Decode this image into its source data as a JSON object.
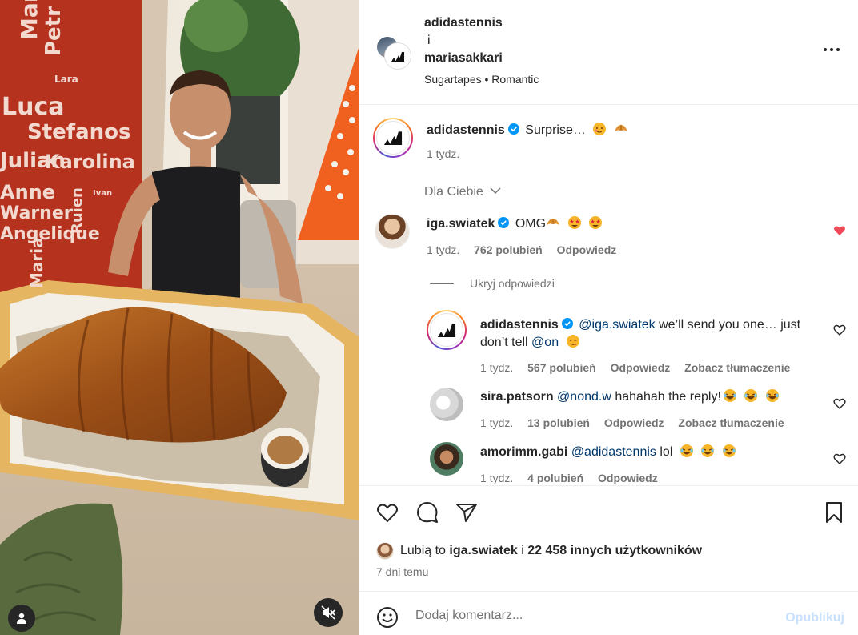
{
  "post": {
    "author": "adidastennis",
    "conjunction": "i",
    "coauthor": "mariasakkari",
    "audio": "Sugartapes • Romantic",
    "caption_text": "Surprise…",
    "caption_time": "1 tydz."
  },
  "media": {
    "wall_names": [
      "Martin",
      "Petr",
      "Lara",
      "Luca",
      "Stefanos",
      "Julian",
      "Karolina",
      "Ivan",
      "Anne",
      "Warner",
      "Ruien",
      "Angelique",
      "Maria"
    ]
  },
  "section_label": "Dla Ciebie",
  "comments": [
    {
      "user": "iga.swiatek",
      "text": "OMG",
      "time": "1 tydz.",
      "likes": "762 polubień",
      "reply": "Odpowiedz",
      "liked": true
    }
  ],
  "hide_replies_label": "Ukryj odpowiedzi",
  "replies": [
    {
      "user": "adidastennis",
      "mention": "@iga.swiatek",
      "text_a": "we’ll send you one… just",
      "text_b": "don’t tell",
      "mention_b": "@on",
      "time": "1 tydz.",
      "likes": "567 polubień",
      "reply": "Odpowiedz",
      "translate": "Zobacz tłumaczenie"
    },
    {
      "user": "sira.patsorn",
      "mention": "@nond.w",
      "text": "hahahah the reply!",
      "time": "1 tydz.",
      "likes": "13 polubień",
      "reply": "Odpowiedz",
      "translate": "Zobacz tłumaczenie"
    },
    {
      "user": "amorimm.gabi",
      "mention": "@adidastennis",
      "text": "lol",
      "time": "1 tydz.",
      "likes": "4 polubień",
      "reply": "Odpowiedz"
    }
  ],
  "likes_summary": {
    "prefix": "Lubią to",
    "user": "iga.swiatek",
    "middle": "i",
    "others": "22 458 innych użytkowników"
  },
  "posted_ago": "7 dni temu",
  "composer": {
    "placeholder": "Dodaj komentarz...",
    "publish_label": "Opublikuj"
  },
  "colors": {
    "heart_liked": "#ed4956",
    "verified": "#0095f6",
    "mention": "#00376b",
    "publish_disabled": "#c7e0fd"
  }
}
